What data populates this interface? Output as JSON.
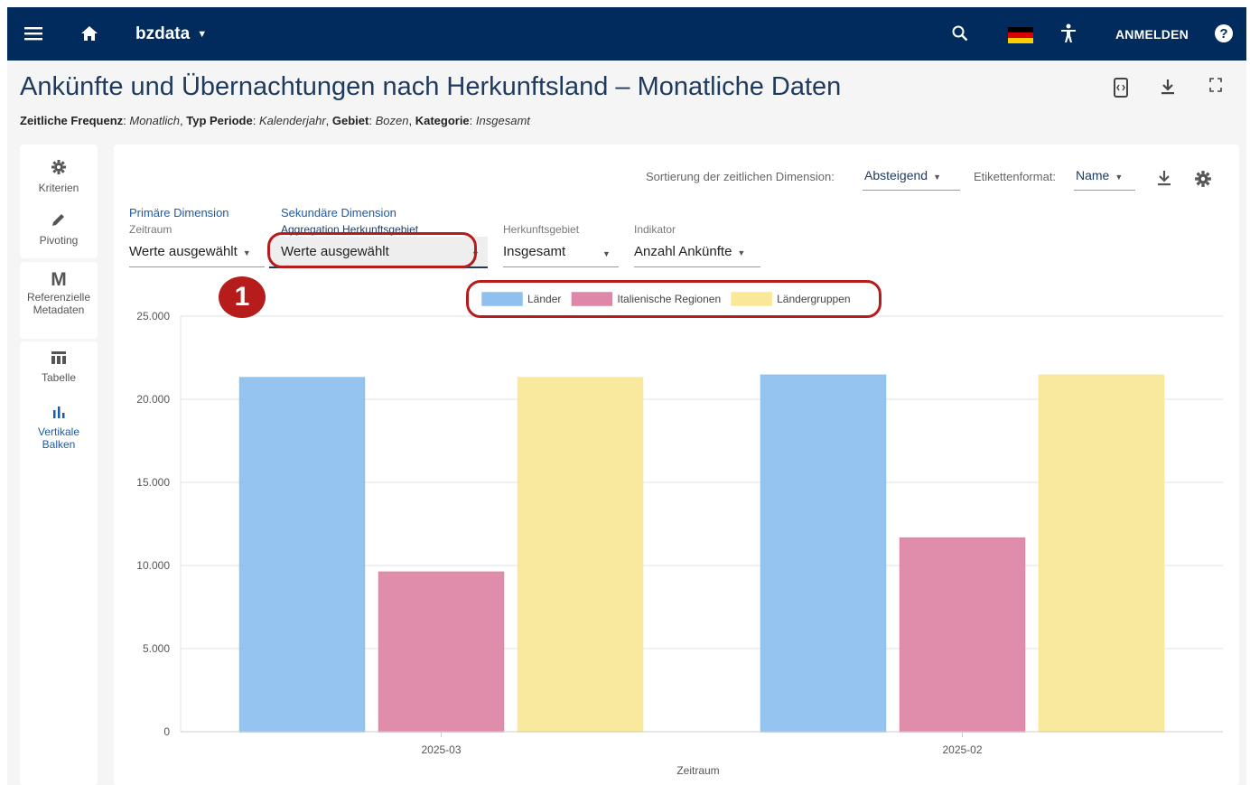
{
  "app": {
    "name": "bzdata",
    "login_label": "ANMELDEN"
  },
  "icons": {
    "menu": "menu-icon",
    "home": "home-icon",
    "search": "search-icon",
    "language": "german-flag-icon",
    "accessibility": "accessibility-icon",
    "help": "help-icon"
  },
  "page": {
    "title": "Ankünfte und Übernachtungen nach Herkunftsland – Monatliche Daten",
    "filters": [
      {
        "label": "Zeitliche Frequenz",
        "value": "Monatlich"
      },
      {
        "label": "Typ Periode",
        "value": "Kalenderjahr"
      },
      {
        "label": "Gebiet",
        "value": "Bozen"
      },
      {
        "label": "Kategorie",
        "value": "Insgesamt"
      }
    ]
  },
  "sidebar": {
    "items": [
      {
        "label": "Kriterien",
        "icon": "gear-icon"
      },
      {
        "label": "Pivoting",
        "icon": "pencil-icon"
      },
      {
        "label": "Referenzielle Metadaten",
        "icon": "M"
      },
      {
        "label": "Tabelle",
        "icon": "table-icon"
      },
      {
        "label": "Vertikale Balken",
        "icon": "bar-chart-icon"
      }
    ]
  },
  "toolbar": {
    "sort_label": "Sortierung der zeitlichen Dimension:",
    "sort_value": "Absteigend",
    "label_format_label": "Etikettenformat:",
    "label_format_value": "Name"
  },
  "dimensions": {
    "primary": {
      "title": "Primäre Dimension",
      "label": "Zeitraum",
      "value": "Werte ausgewählt"
    },
    "secondary": {
      "title": "Sekundäre Dimension",
      "label": "Aggregation Herkunftsgebiet",
      "value": "Werte ausgewählt"
    },
    "origin": {
      "label": "Herkunftsgebiet",
      "value": "Insgesamt"
    },
    "indicator": {
      "label": "Indikator",
      "value": "Anzahl Ankünfte"
    }
  },
  "annotation": {
    "badge": "1"
  },
  "chart_data": {
    "type": "bar",
    "categories": [
      "2025-03",
      "2025-02"
    ],
    "series": [
      {
        "name": "Länder",
        "values": [
          21300,
          21450
        ],
        "color": "#8ec1ee"
      },
      {
        "name": "Italienische Regionen",
        "values": [
          9600,
          11650
        ],
        "color": "#de87a8"
      },
      {
        "name": "Ländergruppen",
        "values": [
          21300,
          21450
        ],
        "color": "#f8e898"
      }
    ],
    "xlabel": "Zeitraum",
    "ylabel": "",
    "ylim": [
      0,
      25000
    ],
    "yticks": [
      "0",
      "5.000",
      "10.000",
      "15.000",
      "20.000",
      "25.000"
    ],
    "grid": true,
    "legend": "top-center"
  }
}
